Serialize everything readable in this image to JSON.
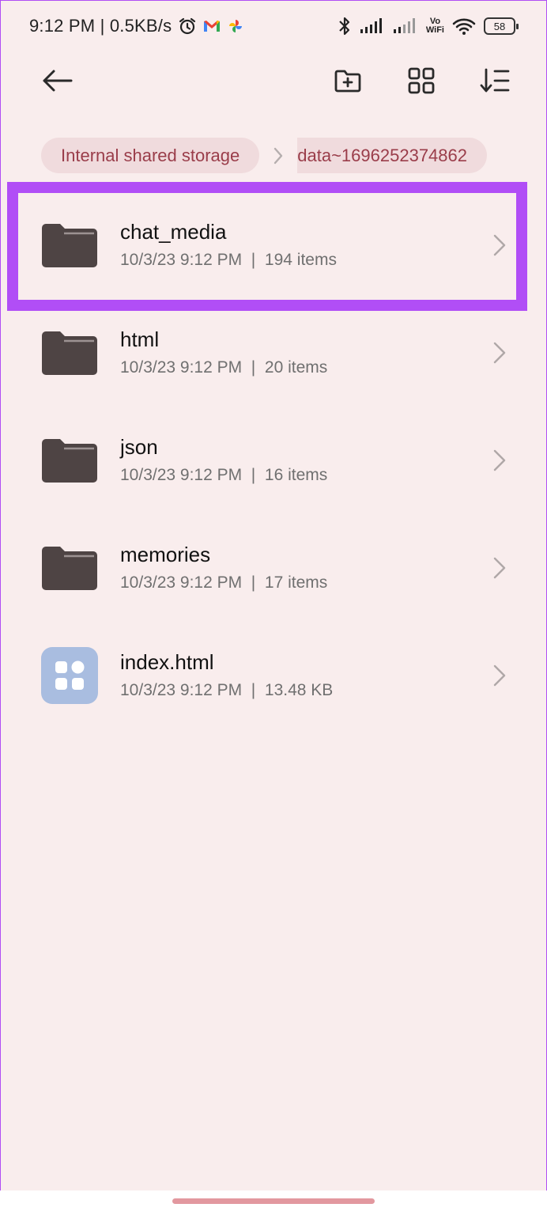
{
  "status_bar": {
    "time_speed": "9:12 PM | 0.5KB/s",
    "vowifi_top": "Vo",
    "vowifi_bottom": "WiFi",
    "battery": "58"
  },
  "toolbar": {
    "back_icon": "arrow-left-icon",
    "new_folder_icon": "folder-plus-icon",
    "grid_view_icon": "grid-icon",
    "sort_icon": "sort-icon"
  },
  "breadcrumb": {
    "root": "Internal shared storage",
    "current": "data~1696252374862"
  },
  "files": [
    {
      "name": "chat_media",
      "date": "10/3/23 9:12 PM",
      "detail": "194 items",
      "type": "folder"
    },
    {
      "name": "html",
      "date": "10/3/23 9:12 PM",
      "detail": "20 items",
      "type": "folder"
    },
    {
      "name": "json",
      "date": "10/3/23 9:12 PM",
      "detail": "16 items",
      "type": "folder"
    },
    {
      "name": "memories",
      "date": "10/3/23 9:12 PM",
      "detail": "17 items",
      "type": "folder"
    },
    {
      "name": "index.html",
      "date": "10/3/23 9:12 PM",
      "detail": "13.48 KB",
      "type": "file"
    }
  ],
  "colors": {
    "background": "#f9eded",
    "highlight": "#b14ef6",
    "folder": "#4e4444",
    "app_icon": "#a9bde0",
    "crumb_bg": "#f0dbdd",
    "crumb_text": "#9a3d4a"
  }
}
